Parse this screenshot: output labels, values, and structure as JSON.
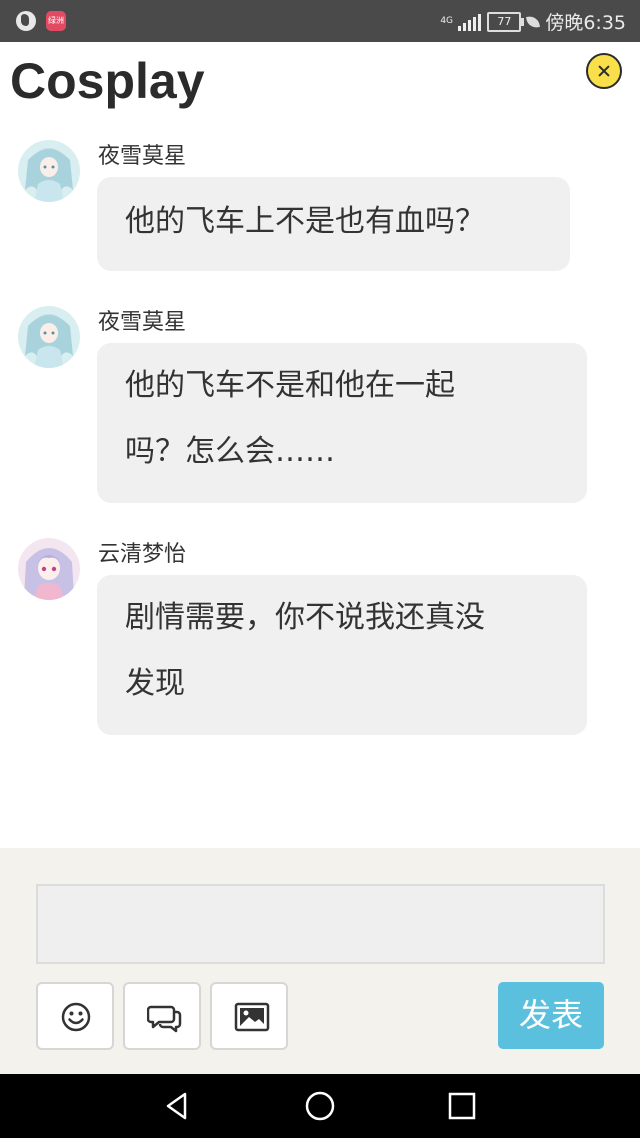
{
  "status_bar": {
    "app_icon_label": "绿洲",
    "network": "4G",
    "battery": "77",
    "time": "傍晚6:35"
  },
  "header": {
    "title": "Cosplay"
  },
  "messages": [
    {
      "username": "夜雪莫星",
      "lines": [
        "他的飞车上不是也有血吗？"
      ]
    },
    {
      "username": "夜雪莫星",
      "lines": [
        "他的飞车不是和他在一起",
        "吗？怎么会……"
      ]
    },
    {
      "username": "云清梦怡",
      "lines": [
        "剧情需要，你不说我还真没",
        "发现"
      ]
    }
  ],
  "compose": {
    "input_value": "",
    "send_label": "发表",
    "tools": [
      "smiley-icon",
      "chat-bubbles-icon",
      "image-icon"
    ]
  },
  "nav_bar": {
    "buttons": [
      "back-icon",
      "home-icon",
      "recents-icon"
    ]
  },
  "colors": {
    "send_button": "#5bc0de",
    "close_button": "#f9e04b",
    "compose_background": "#f3f2ec",
    "bubble_background": "#f0f0f0"
  }
}
